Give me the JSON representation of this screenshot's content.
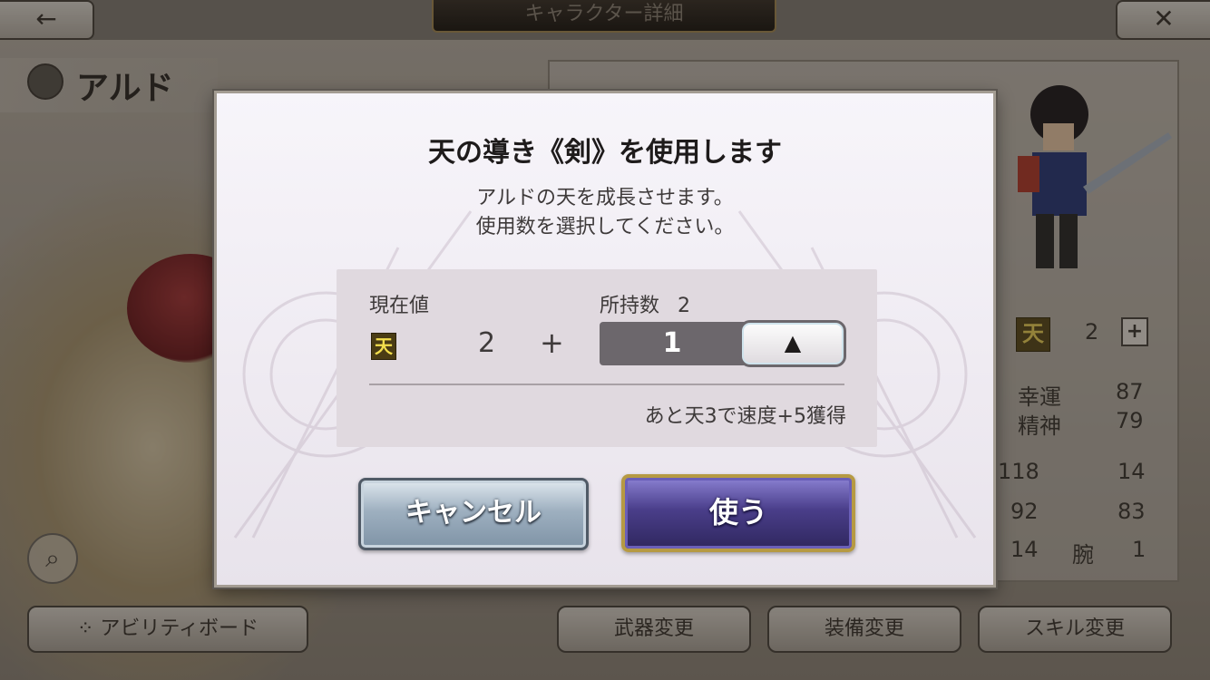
{
  "header": {
    "back_icon": "←",
    "title": "キャラクター詳細",
    "close_icon": "✕"
  },
  "character": {
    "name": "アルド"
  },
  "background_panel": {
    "sky_symbol": "天",
    "sky_value": "2",
    "plus_label": "+",
    "stats": [
      {
        "label": "幸運",
        "value": "87"
      },
      {
        "label": "精神",
        "value": "79"
      }
    ],
    "numbers": [
      {
        "left": "118",
        "right": "14"
      },
      {
        "left": "92",
        "right": "83"
      },
      {
        "left": "14",
        "right_label": "腕",
        "right": "1"
      }
    ]
  },
  "bottom_buttons": {
    "ability_board": "アビリティボード",
    "weapon_change": "武器変更",
    "equipment_change": "装備変更",
    "skill_change": "スキル変更"
  },
  "dialog": {
    "title": "天の導き《剣》を使用します",
    "message": [
      "アルドの天を成長させます。",
      "使用数を選択してください。"
    ],
    "current_label": "現在値",
    "owned_label": "所持数",
    "owned_count": "2",
    "sky_symbol": "天",
    "current_value": "2",
    "plus": "+",
    "quantity": "1",
    "up_arrow": "▲",
    "hint": "あと天3で速度+5獲得",
    "cancel_label": "キャンセル",
    "use_label": "使う"
  },
  "colors": {
    "use_button": "#4a3e8a",
    "cancel_button": "#9eb0c0",
    "modal_bg": "#f3f0f5"
  }
}
